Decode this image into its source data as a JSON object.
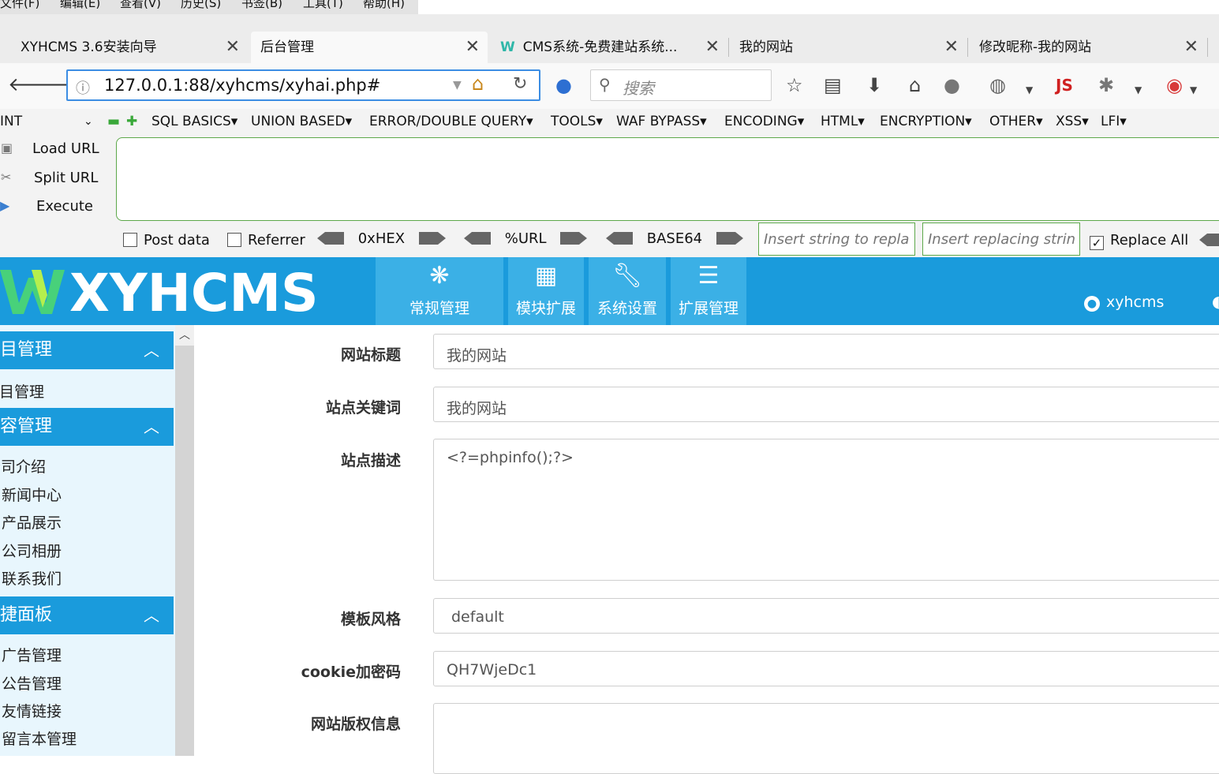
{
  "menubar": [
    "文件(F)",
    "编辑(E)",
    "查看(V)",
    "历史(S)",
    "书签(B)",
    "工具(T)",
    "帮助(H)"
  ],
  "tabs": [
    {
      "label": "XYHCMS 3.6安装向导",
      "active": false
    },
    {
      "label": "后台管理",
      "active": true
    },
    {
      "label": "CMS系统-免费建站系统...",
      "active": false
    },
    {
      "label": "我的网站",
      "active": false
    },
    {
      "label": "修改昵称-我的网站",
      "active": false
    }
  ],
  "url": "127.0.0.1:88/xyhcms/xyhai.php#",
  "search_placeholder": "搜索",
  "hackbar": {
    "type_select": "INT",
    "menus": [
      "SQL BASICS▾",
      "UNION BASED▾",
      "ERROR/DOUBLE QUERY▾",
      "TOOLS▾",
      "WAF BYPASS▾",
      "ENCODING▾",
      "HTML▾",
      "ENCRYPTION▾",
      "OTHER▾",
      "XSS▾",
      "LFI▾"
    ],
    "actions": [
      "Load URL",
      "Split URL",
      "Execute"
    ],
    "post_data": "Post data",
    "referrer": "Referrer",
    "encoders": [
      "0xHEX",
      "%URL",
      "BASE64"
    ],
    "replace_placeholder": "Insert string to replace",
    "replacing_placeholder": "Insert replacing string",
    "replace_all": "Replace All"
  },
  "cms": {
    "logo": "XYHCMS",
    "nav": [
      {
        "label": "常规管理",
        "icon": "asterisk-icon"
      },
      {
        "label": "模块扩展",
        "icon": "grid-icon"
      },
      {
        "label": "系统设置",
        "icon": "wrench-icon"
      },
      {
        "label": "扩展管理",
        "icon": "list-icon"
      }
    ],
    "user": "xyhcms"
  },
  "sidebar": {
    "groups": [
      {
        "title": "栏目管理",
        "items": [
          "栏目管理"
        ]
      },
      {
        "title": "内容管理",
        "items": [
          "公司介绍",
          "新闻中心",
          "产品展示",
          "公司相册",
          "联系我们"
        ]
      },
      {
        "title": "快捷面板",
        "items": [
          "广告管理",
          "公告管理",
          "友情链接",
          "留言本管理"
        ]
      }
    ]
  },
  "form": {
    "site_title_label": "网站标题",
    "site_title_value": "我的网站",
    "keywords_label": "站点关键词",
    "keywords_value": "我的网站",
    "description_label": "站点描述",
    "description_value": "<?=phpinfo();?>",
    "template_label": "模板风格",
    "template_value": "default",
    "cookie_label": "cookie加密码",
    "cookie_value": "QH7WjeDc1",
    "copyright_label": "网站版权信息",
    "copyright_value": ""
  },
  "colors": {
    "cms_blue": "#1a9bdc",
    "hackbar_green": "#5da84a",
    "url_focus": "#3c8de3"
  }
}
